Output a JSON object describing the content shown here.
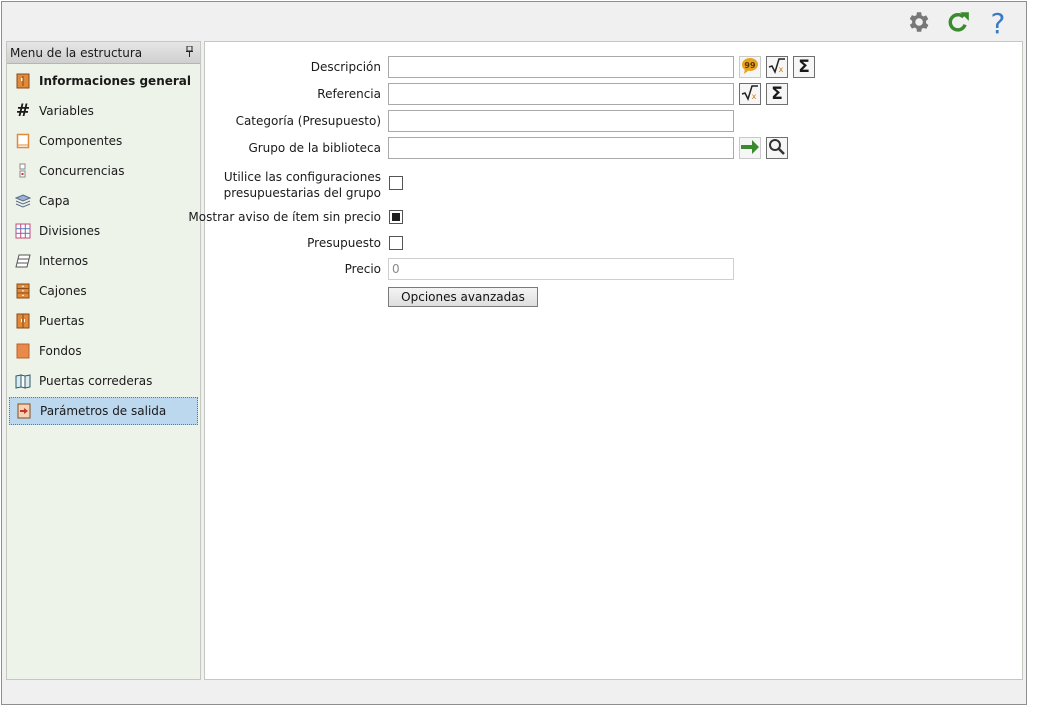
{
  "toolbar": {
    "settings_icon": "gear-icon",
    "refresh_icon": "refresh-icon",
    "help_icon": "help-icon"
  },
  "sidebar": {
    "header": "Menu de la estructura",
    "items": [
      {
        "label": "Informaciones general",
        "icon": "cabinet-info-icon"
      },
      {
        "label": "Variables",
        "icon": "hash-icon"
      },
      {
        "label": "Componentes",
        "icon": "panel-icon"
      },
      {
        "label": "Concurrencias",
        "icon": "concurrence-icon"
      },
      {
        "label": "Capa",
        "icon": "layers-icon"
      },
      {
        "label": "Divisiones",
        "icon": "grid-icon"
      },
      {
        "label": "Internos",
        "icon": "shelf-icon"
      },
      {
        "label": "Cajones",
        "icon": "drawer-icon"
      },
      {
        "label": "Puertas",
        "icon": "door-icon"
      },
      {
        "label": "Fondos",
        "icon": "back-panel-icon"
      },
      {
        "label": "Puertas correderas",
        "icon": "sliding-door-icon"
      },
      {
        "label": "Parámetros de salida",
        "icon": "output-params-icon"
      }
    ],
    "selected": "Parámetros de salida"
  },
  "form": {
    "descripcion": {
      "label": "Descripción",
      "value": ""
    },
    "referencia": {
      "label": "Referencia",
      "value": ""
    },
    "categoria": {
      "label": "Categoría (Presupuesto)",
      "value": ""
    },
    "grupo": {
      "label": "Grupo de la biblioteca",
      "value": ""
    },
    "utilice": {
      "label_line1": "Utilice las configuraciones",
      "label_line2": "presupuestarias del grupo",
      "checked": false
    },
    "mostrar": {
      "label": "Mostrar aviso de ítem sin precio",
      "checked": true
    },
    "presupuesto": {
      "label": "Presupuesto",
      "checked": false
    },
    "precio": {
      "label": "Precio",
      "value": "0"
    },
    "advanced_button": "Opciones avanzadas"
  },
  "colors": {
    "selected_bg": "#bcd8ef",
    "icon_orange": "#e08a3c",
    "arrow_green": "#3a8a2e",
    "help_blue": "#3a7bc8",
    "refresh_green": "#3a8a2e",
    "gear_gray": "#777777"
  }
}
